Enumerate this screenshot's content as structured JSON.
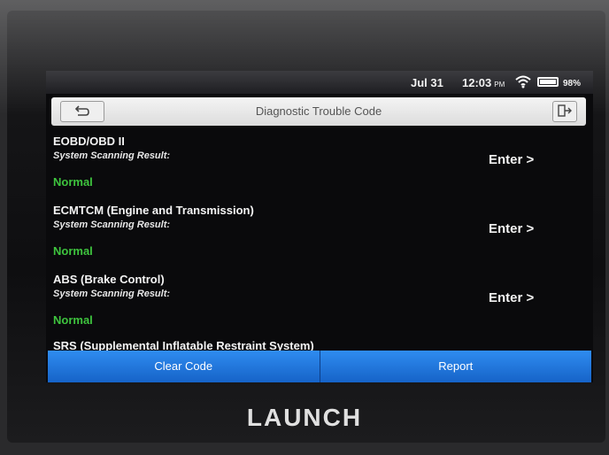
{
  "statusbar": {
    "date": "Jul 31",
    "time": "12:03",
    "ampm": "PM",
    "wifi_icon": "wifi-icon",
    "battery_icon": "battery-icon",
    "battery_pct": "98%"
  },
  "titlebar": {
    "title": "Diagnostic Trouble Code",
    "back_icon": "back-arrow-icon",
    "exit_icon": "exit-icon"
  },
  "systems": [
    {
      "name": "EOBD/OBD II",
      "label": "System Scanning Result:",
      "status": "Normal",
      "action": "Enter >"
    },
    {
      "name": "ECMTCM (Engine and Transmission)",
      "label": "System Scanning Result:",
      "status": "Normal",
      "action": "Enter >"
    },
    {
      "name": "ABS (Brake Control)",
      "label": "System Scanning Result:",
      "status": "Normal",
      "action": "Enter >"
    }
  ],
  "partial_item": "SRS (Supplemental Inflatable Restraint System)",
  "actions": {
    "clear_code": "Clear Code",
    "report": "Report"
  },
  "brand": "LAUNCH",
  "colors": {
    "status_normal": "#3ec43e",
    "action_button": "#1f74dc"
  }
}
